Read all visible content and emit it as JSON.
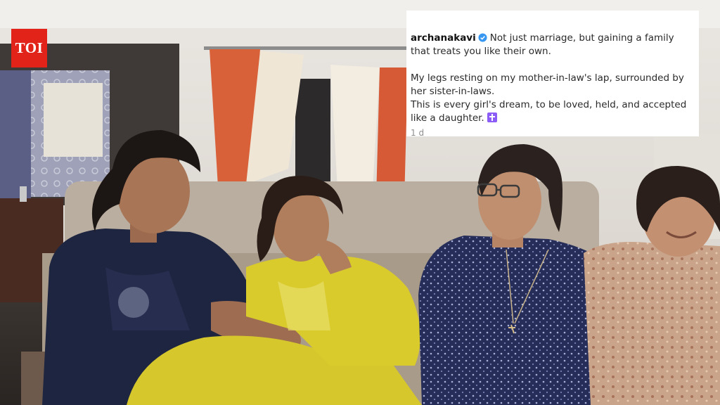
{
  "brand": {
    "logo_text": "TOI",
    "color": "#e2231a"
  },
  "caption": {
    "username": "archanakavi",
    "verified": true,
    "line1": "Not just marriage, but gaining a family that treats you like their own.",
    "line2": "My legs resting on my mother-in-law's lap, surrounded by her sister-in-laws.",
    "line3": "This is every girl's dream, to be loved, held, and accepted like a daughter.",
    "emoji_icon": "latin-cross-emoji",
    "timestamp": "1 d"
  },
  "photo": {
    "subjects": [
      "woman-navy-kurta-left",
      "woman-yellow-outfit",
      "woman-navy-print-glasses",
      "woman-floral-right"
    ],
    "colors": {
      "wall": "#ddd8d2",
      "sofa": "#b8ada0",
      "yellow_outfit": "#d9cb2c",
      "navy": "#242c56"
    }
  }
}
